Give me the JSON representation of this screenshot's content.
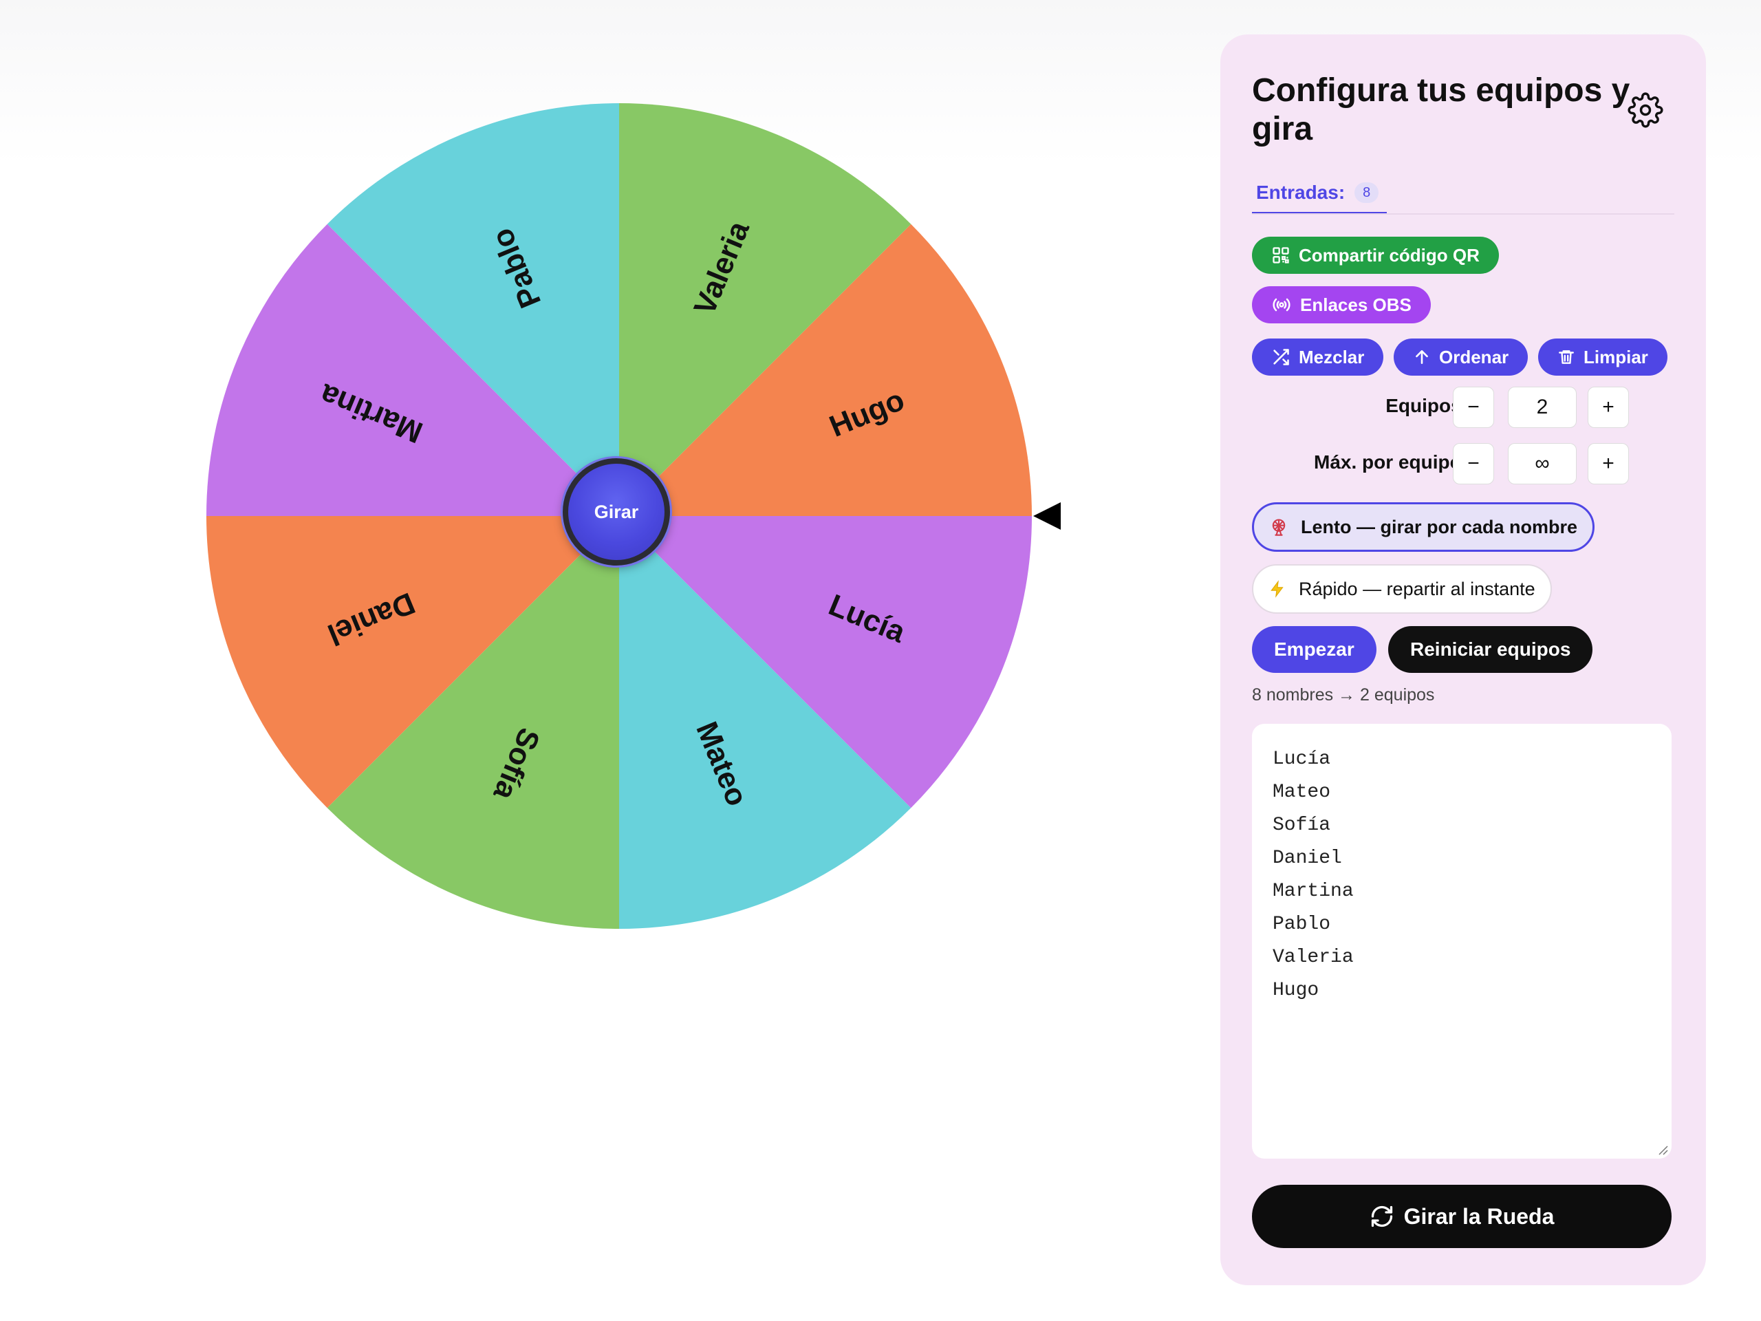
{
  "wheel": {
    "segments": [
      {
        "name": "Hugo",
        "color": "#F4844F"
      },
      {
        "name": "Valeria",
        "color": "#88C865"
      },
      {
        "name": "Pablo",
        "color": "#68D2DB"
      },
      {
        "name": "Martina",
        "color": "#C275EA"
      },
      {
        "name": "Daniel",
        "color": "#F4844F"
      },
      {
        "name": "Sofía",
        "color": "#88C865"
      },
      {
        "name": "Mateo",
        "color": "#68D2DB"
      },
      {
        "name": "Lucía",
        "color": "#C275EA"
      }
    ],
    "center_button": "Girar",
    "pointer_color": "#000000"
  },
  "panel": {
    "title": "Configura tus equipos y gira",
    "tab": {
      "label": "Entradas:",
      "count": "8"
    },
    "buttons": {
      "qr": "Compartir código QR",
      "obs": "Enlaces OBS",
      "shuffle": "Mezclar",
      "sort": "Ordenar",
      "clear": "Limpiar"
    },
    "teams": {
      "label": "Equipos:",
      "value": "2",
      "minus": "−",
      "plus": "+"
    },
    "max_per_team": {
      "label": "Máx. por equipo:",
      "value": "∞",
      "minus": "−",
      "plus": "+"
    },
    "modes": {
      "slow": {
        "icon": "ferris-wheel-icon",
        "label": "Lento — girar por cada nombre",
        "selected": true
      },
      "fast": {
        "icon": "lightning-icon",
        "label": "Rápido — repartir al instante",
        "selected": false
      }
    },
    "start": "Empezar",
    "reset": "Reiniciar equipos",
    "summary": "8 nombres → 2 equipos",
    "names": [
      "Lucía",
      "Mateo",
      "Sofía",
      "Daniel",
      "Martina",
      "Pablo",
      "Valeria",
      "Hugo"
    ],
    "spin": "Girar la Rueda"
  },
  "colors": {
    "accent": "#4F46E5",
    "qr_green": "#22A045",
    "obs_purple": "#A445F0",
    "panel_bg": "#F6E5F6"
  }
}
